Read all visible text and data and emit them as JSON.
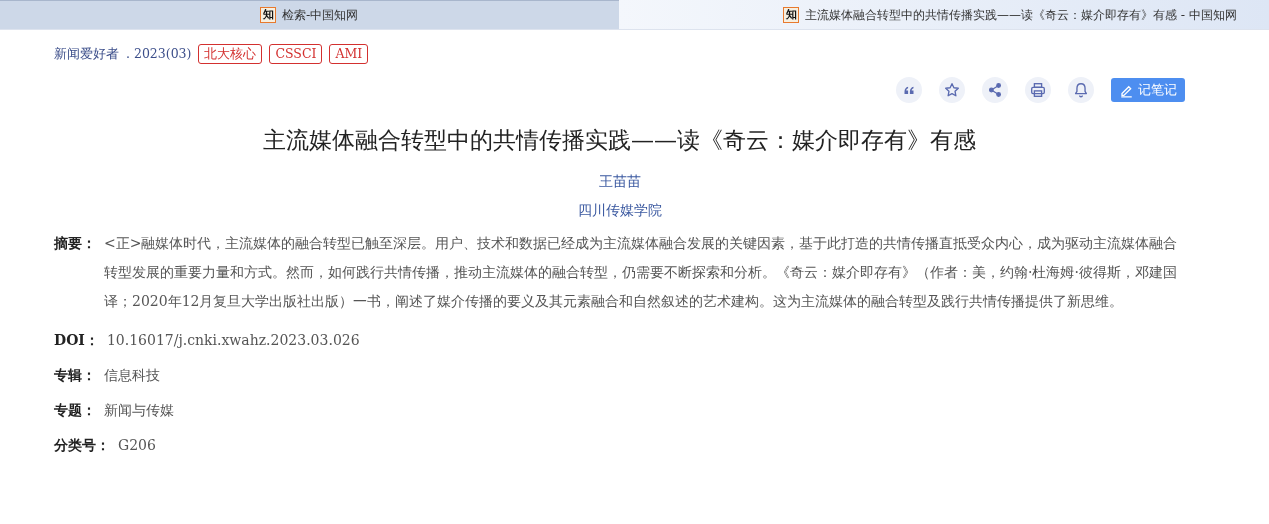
{
  "tabs": [
    {
      "icon_text": "知",
      "label": "检索-中国知网",
      "selected": false
    },
    {
      "icon_text": "知",
      "label": "主流媒体融合转型中的共情传播实践——读《奇云：媒介即存有》有感 - 中国知网",
      "selected": true
    }
  ],
  "source": {
    "journal": "新闻爱好者",
    "issue": ". 2023(03)",
    "tags": [
      "北大核心",
      "CSSCI",
      "AMI"
    ]
  },
  "toolbar": {
    "icons": [
      {
        "kind": "quote"
      },
      {
        "kind": "star"
      },
      {
        "kind": "share"
      },
      {
        "kind": "print"
      },
      {
        "kind": "bell"
      }
    ],
    "note_button": "记笔记"
  },
  "article": {
    "title": "主流媒体融合转型中的共情传播实践——读《奇云：媒介即存有》有感",
    "author": "王苗苗",
    "affiliation": "四川传媒学院",
    "abstract_label": "摘要：",
    "abstract": "<正>融媒体时代，主流媒体的融合转型已触至深层。用户、技术和数据已经成为主流媒体融合发展的关键因素，基于此打造的共情传播直抵受众内心，成为驱动主流媒体融合转型发展的重要力量和方式。然而，如何践行共情传播，推动主流媒体的融合转型，仍需要不断探索和分析。《奇云：媒介即存有》（作者：美，约翰·杜海姆·彼得斯，邓建国译；2020年12月复旦大学出版社出版）一书，阐述了媒介传播的要义及其元素融合和自然叙述的艺术建构。这为主流媒体的融合转型及践行共情传播提供了新思维。",
    "fields": [
      {
        "label": "DOI：",
        "value": "10.16017/j.cnki.xwahz.2023.03.026"
      },
      {
        "label": "专辑：",
        "value": "信息科技"
      },
      {
        "label": "专题：",
        "value": "新闻与传媒"
      },
      {
        "label": "分类号：",
        "value": "G206"
      }
    ]
  }
}
